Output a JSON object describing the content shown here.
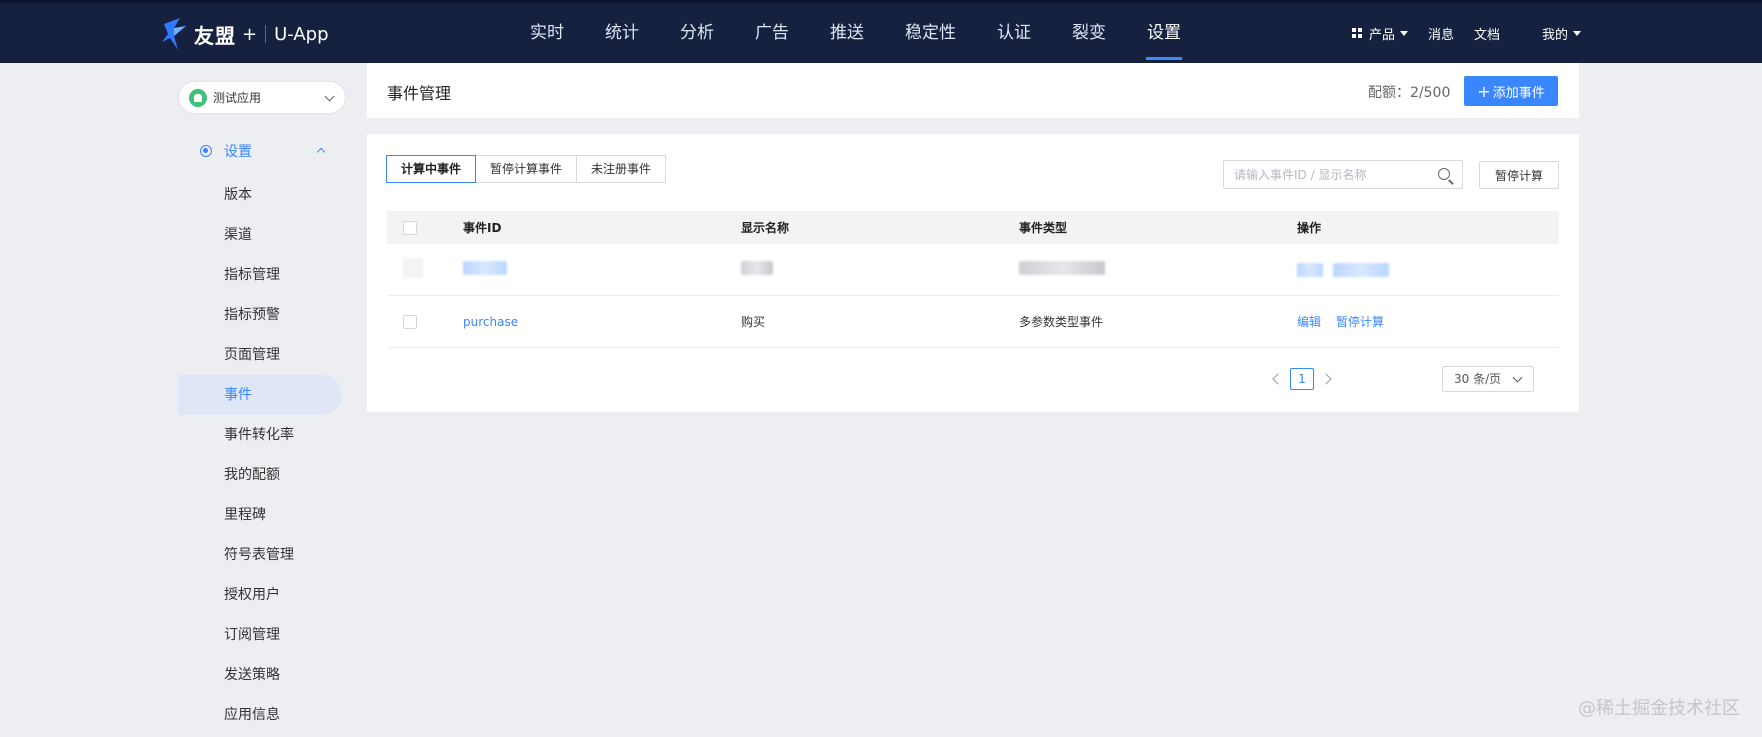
{
  "topbar": {
    "brand": "友盟",
    "plus": "+",
    "product": "U-App",
    "nav": [
      "实时",
      "统计",
      "分析",
      "广告",
      "推送",
      "稳定性",
      "认证",
      "裂变",
      "设置"
    ],
    "active_nav": "设置",
    "right_menu": {
      "products": "产品",
      "messages": "消息",
      "docs": "文档",
      "mine": "我的"
    },
    "colors": {
      "background": "#16213f",
      "accent": "#3c8cff"
    }
  },
  "sidebar": {
    "app_name": "测试应用",
    "section": "设置",
    "items": [
      "版本",
      "渠道",
      "指标管理",
      "指标预警",
      "页面管理",
      "事件",
      "事件转化率",
      "我的配额",
      "里程碑",
      "符号表管理",
      "授权用户",
      "订阅管理",
      "发送策略",
      "应用信息"
    ],
    "active_item": "事件"
  },
  "header": {
    "title": "事件管理",
    "quota": "配额：2/500",
    "add_button": "添加事件"
  },
  "main": {
    "tabs": [
      "计算中事件",
      "暂停计算事件",
      "未注册事件"
    ],
    "active_tab": "计算中事件",
    "search_placeholder": "请输入事件ID / 显示名称",
    "pause_button": "暂停计算",
    "table": {
      "columns": [
        "事件ID",
        "显示名称",
        "事件类型",
        "操作"
      ],
      "rows": [
        {
          "id": "purchase",
          "name": "购买",
          "type": "多参数类型事件",
          "ops": [
            "编辑",
            "暂停计算"
          ]
        }
      ]
    },
    "pagination": {
      "current_page": "1",
      "page_size": "30 条/页"
    }
  },
  "watermark": "@稀土掘金技术社区",
  "accent_color": "#3a86ff"
}
